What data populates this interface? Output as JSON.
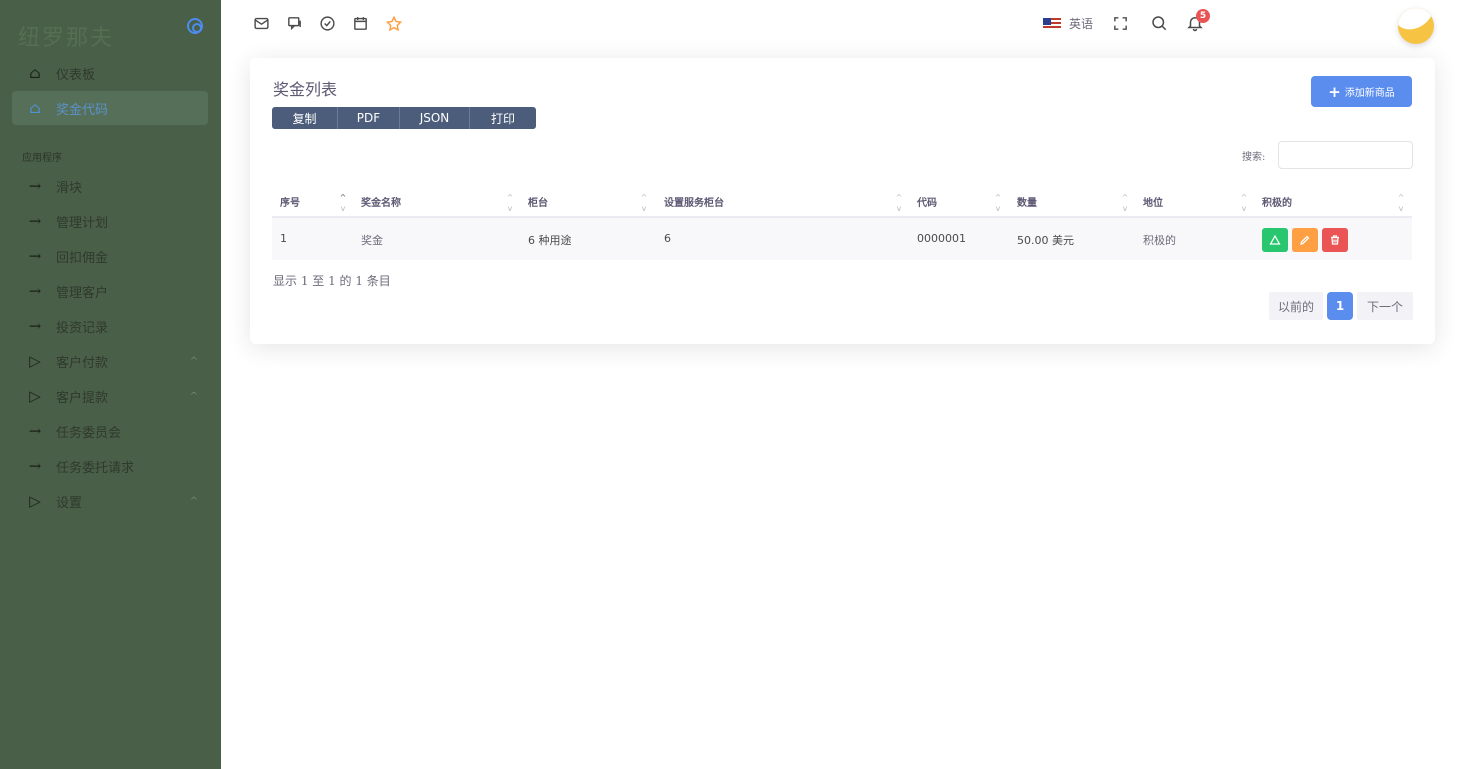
{
  "sidebar": {
    "brand": "纽罗那夫",
    "section_label": "应用程序",
    "items": [
      {
        "label": "仪表板"
      },
      {
        "label": "奖金代码"
      },
      {
        "label": "滑块"
      },
      {
        "label": "管理计划"
      },
      {
        "label": "回扣佣金"
      },
      {
        "label": "管理客户"
      },
      {
        "label": "投资记录"
      },
      {
        "label": "客户付款"
      },
      {
        "label": "客户提款"
      },
      {
        "label": "任务委员会"
      },
      {
        "label": "任务委托请求"
      },
      {
        "label": "设置"
      }
    ]
  },
  "header": {
    "language": "英语",
    "notification_count": "5"
  },
  "card": {
    "title": "奖金列表",
    "export_buttons": [
      "复制",
      "PDF",
      "JSON",
      "打印"
    ],
    "add_button": "添加新商品",
    "search_label": "搜索:",
    "search_value": ""
  },
  "table": {
    "columns": [
      "序号",
      "奖金名称",
      "柜台",
      "设置服务柜台",
      "代码",
      "数量",
      "地位",
      "积极的"
    ],
    "rows": [
      {
        "no": "1",
        "name": "奖金",
        "counter": "6 种用途",
        "service_counter": "6",
        "code": "0000001",
        "amount": "50.00 美元",
        "status": "积极的"
      }
    ]
  },
  "footer": {
    "info": "显示 1 至 1 的 1 条目",
    "prev": "以前的",
    "current_page": "1",
    "next": "下一个"
  },
  "colors": {
    "sidebar_bg": "#4a5f47",
    "primary": "#5b8def",
    "success": "#28c76f",
    "warning": "#ff9f43",
    "danger": "#ea5455"
  }
}
